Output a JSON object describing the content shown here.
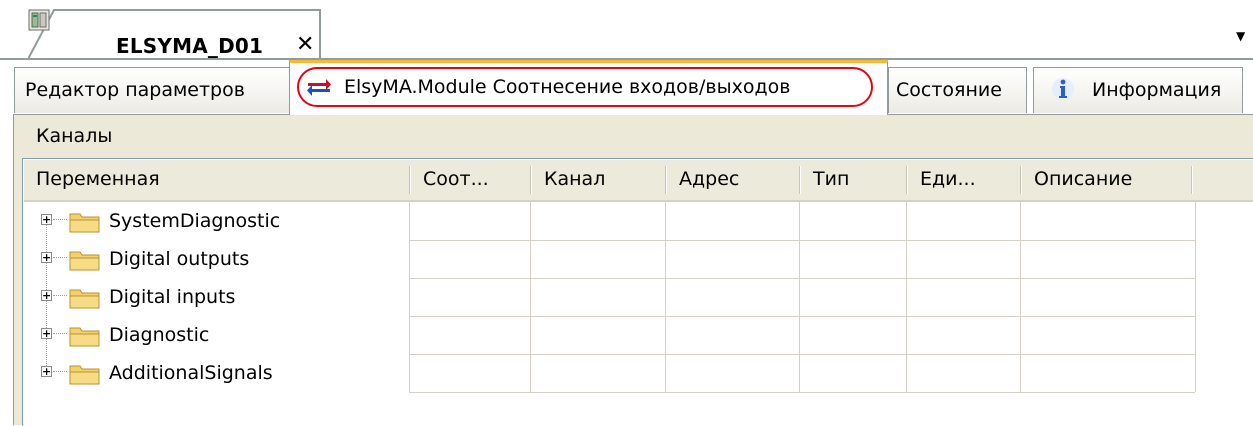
{
  "document_tab": {
    "title": "ELSYMA_D01",
    "close_glyph": "✕",
    "icon": "device-icon"
  },
  "strip_menu_glyph": "▼",
  "tabs": [
    {
      "label": "Редактор параметров"
    },
    {
      "label": "ElsyMA.Module Соотнесение входов/выходов",
      "active": true,
      "highlight_color": "#e30613",
      "icon": "io-mapping-icon"
    },
    {
      "label": "Состояние"
    },
    {
      "label": "Информация",
      "icon": "info-icon"
    }
  ],
  "panel": {
    "title": "Каналы"
  },
  "table": {
    "columns": [
      "Переменная",
      "Соот...",
      "Канал",
      "Адрес",
      "Тип",
      "Еди...",
      "Описание"
    ],
    "rows": [
      {
        "label": "SystemDiagnostic",
        "expander": "+"
      },
      {
        "label": "Digital outputs",
        "expander": "+"
      },
      {
        "label": "Digital inputs",
        "expander": "+"
      },
      {
        "label": "Diagnostic",
        "expander": "+"
      },
      {
        "label": "AdditionalSignals",
        "expander": "+"
      }
    ]
  },
  "colors": {
    "active_tab_accent": "#f9b934",
    "highlight_oval": "#e30613",
    "panel_bg": "#ece9d8",
    "folder": "#f3d16c"
  }
}
